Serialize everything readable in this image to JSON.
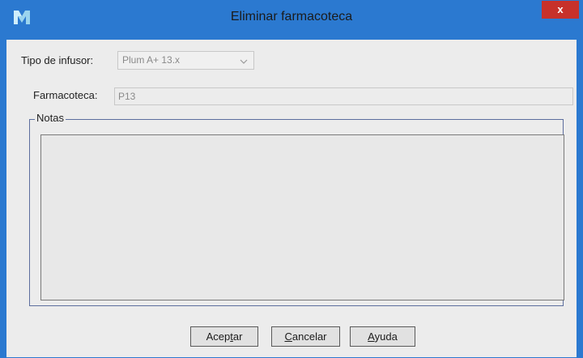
{
  "window": {
    "title": "Eliminar farmacoteca",
    "close_label": "x",
    "app_icon": "app-logo-icon"
  },
  "form": {
    "infusor_label": "Tipo de infusor:",
    "infusor_value": "Plum A+ 13.x",
    "farmacoteca_label": "Farmacoteca:",
    "farmacoteca_value": "P13",
    "notes_label": "Notas",
    "notes_value": ""
  },
  "buttons": {
    "accept": {
      "before": "Acep",
      "mnemonic": "t",
      "after": "ar"
    },
    "cancel": {
      "before": "",
      "mnemonic": "C",
      "after": "ancelar"
    },
    "help": {
      "before": "",
      "mnemonic": "A",
      "after": "yuda"
    }
  },
  "colors": {
    "titlebar": "#2b79d0",
    "close": "#c7312a",
    "client_background": "#ececec"
  }
}
